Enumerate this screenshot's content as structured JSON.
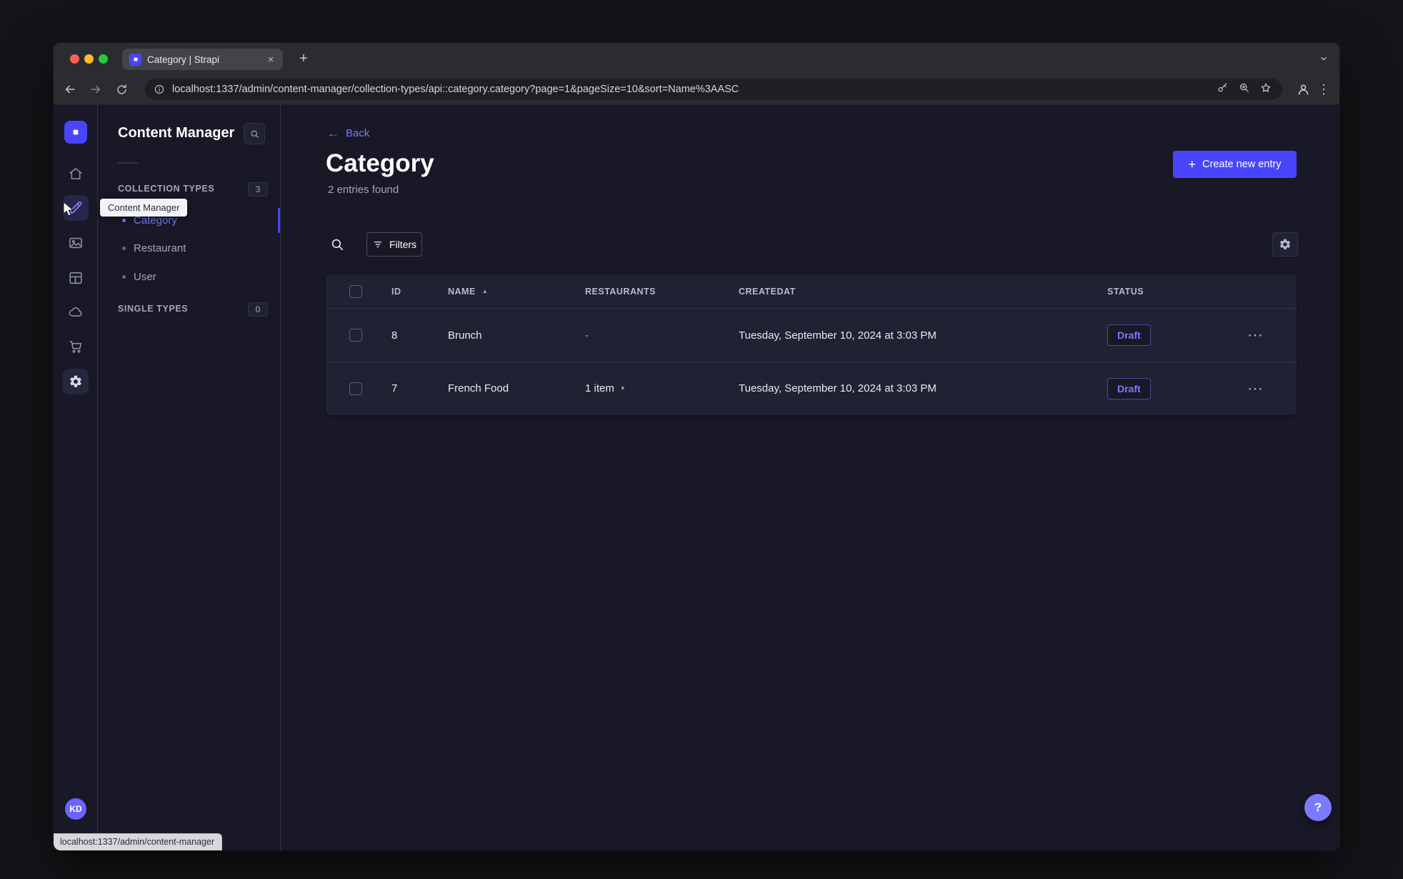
{
  "colors": {
    "primary": "#4945ff",
    "primary_light": "#7b79ff",
    "app_bg": "#181826",
    "surface": "#212134",
    "border": "#32324d"
  },
  "browser": {
    "tab_title": "Category | Strapi",
    "url": "localhost:1337/admin/content-manager/collection-types/api::category.category?page=1&pageSize=10&sort=Name%3AASC",
    "status_bubble": "localhost:1337/admin/content-manager"
  },
  "icons": {
    "plus": "+",
    "close": "×",
    "back_arrow": "←",
    "sort_asc": "▲",
    "caret_down": "▼",
    "row_actions": "⋯",
    "browser_menu": "⋮",
    "help": "?"
  },
  "rail": {
    "avatar_initials": "KD"
  },
  "sidebar": {
    "title": "Content Manager",
    "tooltip": "Content Manager",
    "sections": [
      {
        "label": "COLLECTION TYPES",
        "badge": "3"
      },
      {
        "label": "SINGLE TYPES",
        "badge": "0"
      }
    ],
    "items": [
      {
        "label": "Category"
      },
      {
        "label": "Restaurant"
      },
      {
        "label": "User"
      }
    ]
  },
  "main": {
    "back_label": "Back",
    "title": "Category",
    "subtitle": "2 entries found",
    "create_button": "Create new entry",
    "filters_button": "Filters",
    "table": {
      "headers": [
        "ID",
        "NAME",
        "RESTAURANTS",
        "CREATEDAT",
        "STATUS"
      ],
      "rows": [
        {
          "id": "8",
          "name": "Brunch",
          "restaurants": "-",
          "created": "Tuesday, September 10, 2024 at 3:03 PM",
          "status": "Draft"
        },
        {
          "id": "7",
          "name": "French Food",
          "restaurants": "1 item",
          "created": "Tuesday, September 10, 2024 at 3:03 PM",
          "status": "Draft"
        }
      ]
    }
  }
}
